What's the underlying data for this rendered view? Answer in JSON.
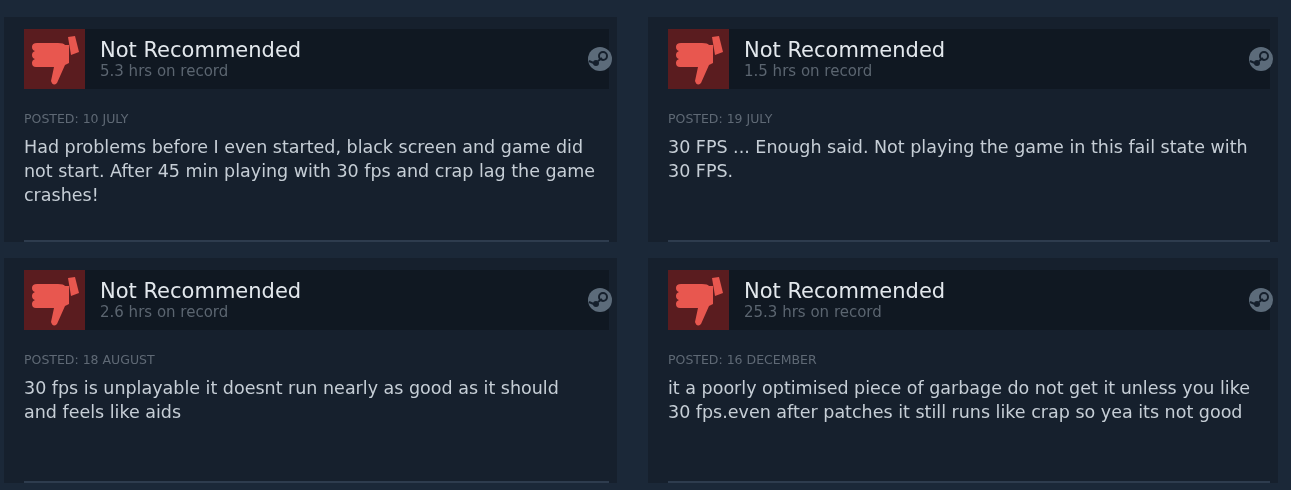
{
  "reviews": [
    {
      "recommended": false,
      "title": "Not Recommended",
      "hours": "5.3 hrs on record",
      "posted": "POSTED: 10 JULY",
      "text": "Had problems before I even started, black screen and game did not start. After 45 min playing with 30 fps and crap lag the game crashes!"
    },
    {
      "recommended": false,
      "title": "Not Recommended",
      "hours": "1.5 hrs on record",
      "posted": "POSTED: 19 JULY",
      "text": "30 FPS ... Enough said. Not playing the game in this fail state with 30 FPS."
    },
    {
      "recommended": false,
      "title": "Not Recommended",
      "hours": "2.6 hrs on record",
      "posted": "POSTED: 18 AUGUST",
      "text": "30 fps is unplayable it doesnt run nearly as good as it should and feels like aids"
    },
    {
      "recommended": false,
      "title": "Not Recommended",
      "hours": "25.3 hrs on record",
      "posted": "POSTED: 16 DECEMBER",
      "text": "it a poorly optimised piece of garbage do not get it unless you like 30 fps.even after patches it still runs like crap so yea its not good"
    }
  ]
}
